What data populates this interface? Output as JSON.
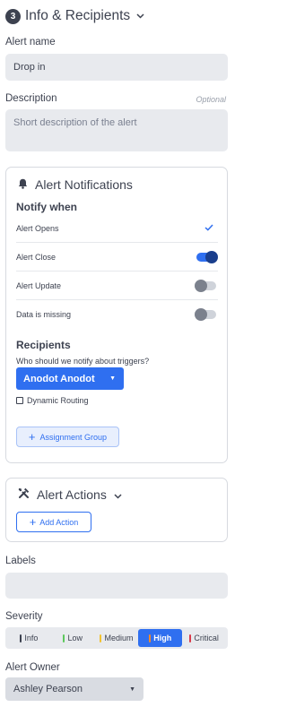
{
  "section": {
    "step": "3",
    "title": "Info & Recipients"
  },
  "alert_name": {
    "label": "Alert name",
    "value": "Drop in"
  },
  "description": {
    "label": "Description",
    "optional": "Optional",
    "placeholder": "Short description of the alert"
  },
  "notifications": {
    "title": "Alert Notifications",
    "notify_when": "Notify when",
    "rows": [
      {
        "label": "Alert Opens",
        "control": "check"
      },
      {
        "label": "Alert Close",
        "control": "toggle",
        "on": true
      },
      {
        "label": "Alert Update",
        "control": "toggle",
        "on": false
      },
      {
        "label": "Data is missing",
        "control": "toggle",
        "on": false
      }
    ],
    "recipients": {
      "title": "Recipients",
      "question": "Who should we notify about triggers?",
      "selected": "Anodot Anodot",
      "dynamic_routing": "Dynamic Routing",
      "assignment_group": "Assignment Group"
    }
  },
  "actions": {
    "title": "Alert Actions",
    "add_action": "Add Action"
  },
  "labels": {
    "label": "Labels",
    "value": ""
  },
  "severity": {
    "label": "Severity",
    "selected": "High",
    "options": [
      {
        "label": "Info",
        "color": "#3d4250"
      },
      {
        "label": "Low",
        "color": "#5cc85c"
      },
      {
        "label": "Medium",
        "color": "#f2c230"
      },
      {
        "label": "High",
        "color": "#f58a2a"
      },
      {
        "label": "Critical",
        "color": "#d93a4a"
      }
    ]
  },
  "owner": {
    "label": "Alert Owner",
    "value": "Ashley Pearson"
  },
  "colors": {
    "accent": "#2f6ff0",
    "field_bg": "#e8eaee",
    "text": "#3d4250"
  }
}
